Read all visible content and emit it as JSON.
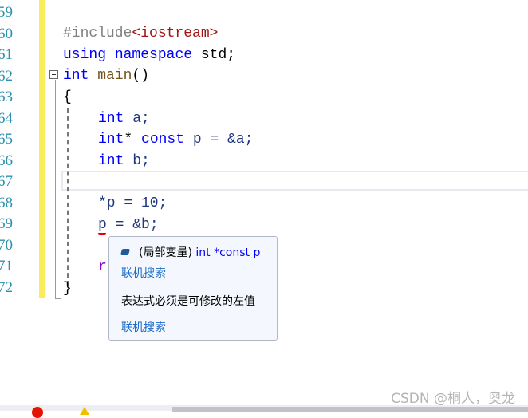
{
  "editor": {
    "line_numbers": [
      "59",
      "60",
      "61",
      "62",
      "63",
      "64",
      "65",
      "66",
      "67",
      "68",
      "69",
      "70",
      "71",
      "72"
    ],
    "lines": {
      "l60": {
        "directive": "#include",
        "header": "<iostream>"
      },
      "l61": {
        "kw1": "using",
        "kw2": "namespace",
        "rest": " std;"
      },
      "l62": {
        "kw": "int",
        "fn": " main",
        "rest": "()"
      },
      "l63": "{",
      "l64": {
        "kw": "int",
        "rest": " a;"
      },
      "l65": {
        "kw": "int",
        "star": "*",
        "kw2": " const",
        "rest": " p = &a;"
      },
      "l66": {
        "kw": "int",
        "rest": " b;"
      },
      "l68": "*p = 10;",
      "l69": {
        "var": "p",
        "rest": " = &b;"
      },
      "l71": "r",
      "l72": "}"
    }
  },
  "tooltip": {
    "icon": "local-variable-cube-icon",
    "signature_prefix": "(局部变量) ",
    "signature_type": "int *const p",
    "search_link_1": "联机搜索",
    "error_message": "表达式必须是可修改的左值",
    "search_link_2": "联机搜索"
  },
  "status_bar": {
    "errors_icon": "error-icon",
    "warnings_icon": "warning-icon"
  },
  "watermark": "CSDN @桐人，奥龙",
  "colors": {
    "keyword": "#0000ff",
    "gutter": "#fbec5d",
    "link": "#1a6ac6",
    "error": "#e51400"
  }
}
